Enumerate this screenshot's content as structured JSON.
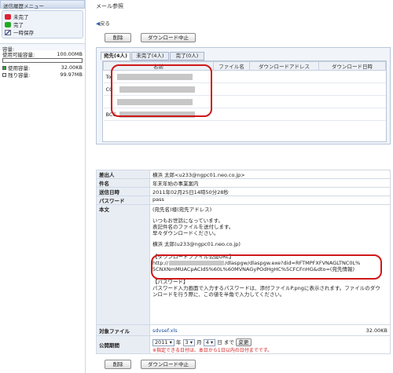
{
  "sidebar": {
    "header": "送信履歴メニュー",
    "items": [
      {
        "label": "未完了",
        "icon": "unfinished-icon"
      },
      {
        "label": "完了",
        "icon": "finished-icon"
      },
      {
        "label": "一時保存",
        "icon": "draft-icon"
      }
    ],
    "capacity": {
      "header": "容量:",
      "available_label": "使用可能容量:",
      "available_value": "100.00MB",
      "used_label": "使用容量:",
      "used_value": "32.00KB",
      "remaining_label": "残り容量:",
      "remaining_value": "99.97MB",
      "used_fraction": 0.0003
    }
  },
  "main": {
    "title": "メール参照",
    "back_label": "戻る",
    "delete_label": "削除",
    "stop_label": "ダウンロード中止",
    "tabs": [
      "宛先(4人)",
      "未完了(4人)",
      "完了(0人)"
    ],
    "recipients": {
      "headers": [
        "名前",
        "ファイル名",
        "ダウンロードアドレス",
        "ダウンロード日時"
      ],
      "rows": [
        {
          "kind": "To"
        },
        {
          "kind": "CC"
        },
        {
          "kind": ""
        },
        {
          "kind": "BCC"
        }
      ]
    },
    "details": {
      "sender_label": "差出人",
      "sender_value": "横浜 太郎<u233@ngpc01.neo.co.jp>",
      "subject_label": "件名",
      "subject_value": "年末年始の事業案内",
      "date_label": "送信日時",
      "date_value": "2011年02月25日14時50分28秒",
      "password_label": "パスワード",
      "password_value": "pass",
      "body_label": "本文",
      "body_lines": [
        "(宛先名)様(宛先アドレス)",
        "",
        "いつもお世話になっています。",
        "表記件名のファイルを送付します。",
        "早々ダウンロードください。",
        "",
        "横浜 太郎(u233@ngpc01.neo.co.jp)"
      ],
      "dl_heading": "【ダウンロードファイル公開URL】",
      "dl_url_prefix": "http://",
      "dl_url_mid": "/dlaspgw/dlaspgw.exe?did=RFTMPFXFVNAGLTNC0L%",
      "dl_url_line2": "5CNXNmMUACpACIdS%60L%60MVNAGyPOdHgHC%5CFCFnHG&dto=(宛先情報)",
      "pw_heading": "【パスワード】",
      "pw_text": "パスワード入力画面で入力するパスワードは、添付ファイルP.pngに表示されます。ファイルのダウンロードを行う際に、この値を半角で入力してください。",
      "file_label": "対象ファイル",
      "file_name": "sdvsef.xls",
      "file_size": "32.00KB",
      "period_label": "公開期間",
      "year": "2011",
      "year_unit": "年",
      "month": "3",
      "month_unit": "月",
      "day": "4",
      "day_unit": "日",
      "until": "まで",
      "change_label": "変更",
      "period_note": "※指定できる日付は、本日から1日以内の日付までです。"
    }
  },
  "colors": {
    "highlight": "#d01818",
    "header_bg": "#e8edf4"
  }
}
